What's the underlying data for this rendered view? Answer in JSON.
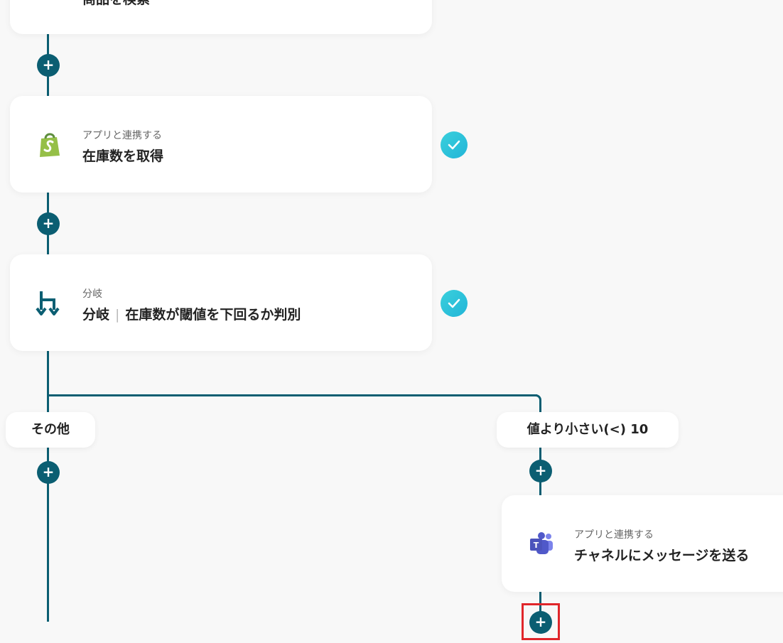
{
  "steps": {
    "search": {
      "title": "商品を検索"
    },
    "shopify": {
      "subtitle": "アプリと連携する",
      "title": "在庫数を取得",
      "icon": "shopify-icon"
    },
    "branch": {
      "subtitle": "分岐",
      "title_main": "分岐",
      "title_detail": "在庫数が閾値を下回るか判別",
      "icon": "branch-icon"
    },
    "teams": {
      "subtitle": "アプリと連携する",
      "title": "チャネルにメッセージを送る",
      "icon": "teams-icon"
    }
  },
  "branches": {
    "left_label": "その他",
    "right_label": "値より小さい(<) 10"
  },
  "add_symbol": "+",
  "colors": {
    "accent": "#0b5e72",
    "check": "#2bc3d9",
    "highlight": "#e0262b",
    "shopify": "#95bf47",
    "teams": "#5059c9"
  }
}
